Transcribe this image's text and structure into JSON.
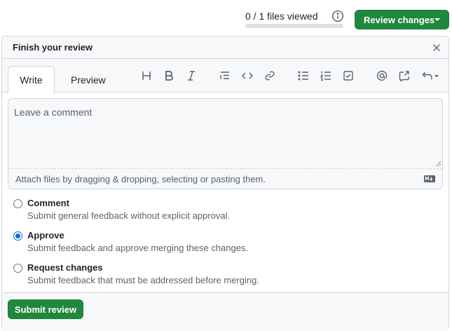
{
  "header": {
    "files_viewed": "0 / 1 files viewed",
    "files_viewed_fraction": 0,
    "review_button_label": "Review changes"
  },
  "panel": {
    "title": "Finish your review",
    "tabs": [
      {
        "label": "Write",
        "active": true
      },
      {
        "label": "Preview",
        "active": false
      }
    ],
    "toolbar": [
      "heading-icon",
      "bold-icon",
      "italic-icon",
      "quote-icon",
      "code-icon",
      "link-icon",
      "unordered-list-icon",
      "ordered-list-icon",
      "task-list-icon",
      "mention-icon",
      "cross-reference-icon",
      "reply-icon"
    ],
    "comment": {
      "placeholder": "Leave a comment",
      "value": "",
      "attach_text": "Attach files by dragging & dropping, selecting or pasting them."
    },
    "options": [
      {
        "title": "Comment",
        "desc": "Submit general feedback without explicit approval.",
        "checked": false
      },
      {
        "title": "Approve",
        "desc": "Submit feedback and approve merging these changes.",
        "checked": true
      },
      {
        "title": "Request changes",
        "desc": "Submit feedback that must be addressed before merging.",
        "checked": false
      }
    ],
    "submit_label": "Submit review"
  },
  "colors": {
    "primary_green": "#1f883d",
    "selected_blue": "#0969da",
    "muted_text": "#59636e"
  }
}
